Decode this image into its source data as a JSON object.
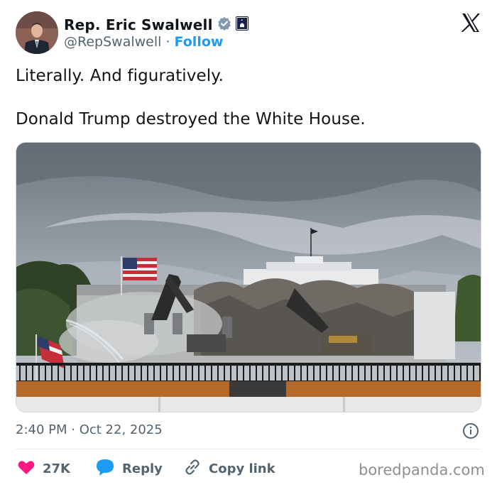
{
  "author": {
    "name": "Rep. Eric Swalwell",
    "handle": "@RepSwalwell",
    "separator": " · ",
    "follow_label": "Follow",
    "verified_icon": "gray-verified-badge-icon",
    "affiliation_icon": "government-seal-icon"
  },
  "platform": {
    "logo_icon": "x-logo-icon"
  },
  "tweet": {
    "line1": "Literally. And figuratively.",
    "line2": "Donald Trump destroyed the White House."
  },
  "meta": {
    "timestamp": "2:40 PM · Oct 22, 2025",
    "info_icon": "info-icon"
  },
  "actions": {
    "like_count": "27K",
    "like_icon": "heart-icon",
    "reply_label": "Reply",
    "reply_icon": "comment-icon",
    "copy_label": "Copy link",
    "copy_icon": "link-icon"
  },
  "watermark": "boredpanda.com",
  "colors": {
    "accent": "#1d9bf0",
    "like": "#f91880",
    "text": "#0f1419",
    "muted": "#536471"
  }
}
